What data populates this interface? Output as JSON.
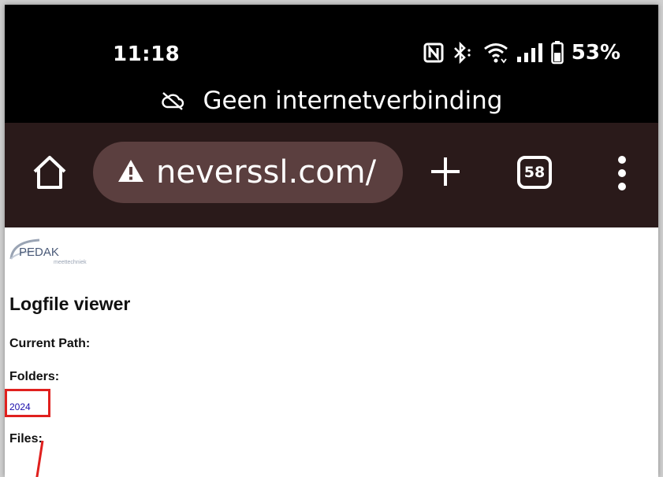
{
  "status_bar": {
    "time": "11:18",
    "battery": "53%",
    "icons": [
      "nfc-icon",
      "bluetooth-icon",
      "wifi-icon",
      "signal-icon",
      "battery-icon"
    ]
  },
  "offline_banner": {
    "text": "Geen internetverbinding",
    "icon": "cloud-off-icon"
  },
  "browser": {
    "url": "neverssl.com/",
    "tab_count": "58",
    "toolbar_color": "#2a1a1a",
    "pill_color": "#5b3f3f"
  },
  "page": {
    "logo_text": "PEDAK",
    "logo_subtext": "meettechniek",
    "title": "Logfile viewer",
    "current_path_label": "Current Path:",
    "folders_label": "Folders:",
    "folders": [
      "2024"
    ],
    "files_label": "Files:"
  },
  "annotation": {
    "color": "#e0201e"
  }
}
